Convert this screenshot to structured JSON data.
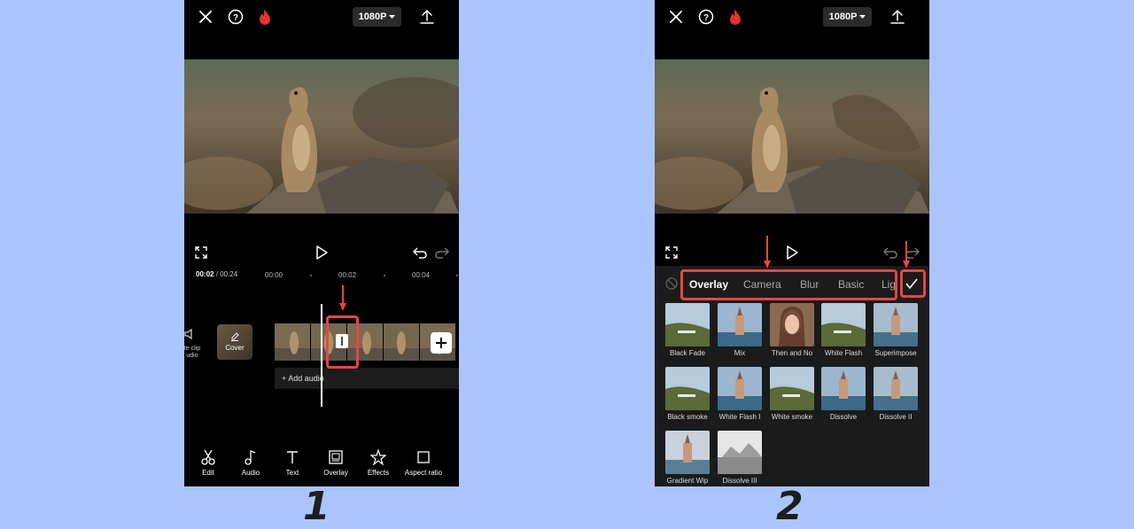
{
  "colors": {
    "background": "#abc4fb",
    "highlight": "#e84545",
    "flame": "#e5332a"
  },
  "icons": [
    "close-icon",
    "help-icon",
    "flame-icon",
    "chevron-down-icon",
    "export-icon",
    "fullscreen-icon",
    "play-icon",
    "undo-icon",
    "redo-icon",
    "speaker-icon",
    "pencil-icon",
    "plus-icon",
    "scissors-icon",
    "music-note-icon",
    "text-icon",
    "overlay-icon",
    "effects-icon",
    "aspect-ratio-icon",
    "none-icon",
    "checkmark-icon"
  ],
  "screen1": {
    "resolution": "1080P",
    "current_time": "00:02",
    "separator": "/",
    "total_time": "00:24",
    "ticks": [
      "00:00",
      "00:02",
      "00:04"
    ],
    "mute_label": "te clip udio",
    "cover_label": "Cover",
    "add_audio_label": "+ Add audio",
    "tools": [
      "Edit",
      "Audio",
      "Text",
      "Overlay",
      "Effects",
      "Aspect ratio"
    ],
    "step_number": "1"
  },
  "screen2": {
    "resolution": "1080P",
    "tabs": [
      "Overlay",
      "Camera",
      "Blur",
      "Basic",
      "Lig"
    ],
    "active_tab": "Overlay",
    "effects": [
      "Black Fade",
      "Mix",
      "Then and No",
      "White Flash",
      "Superimpose",
      "Black smoke",
      "White Flash I",
      "White smoke",
      "Dissolve",
      "Dissolve II",
      "Gradient Wip",
      "Dissolve III"
    ],
    "step_number": "2"
  }
}
